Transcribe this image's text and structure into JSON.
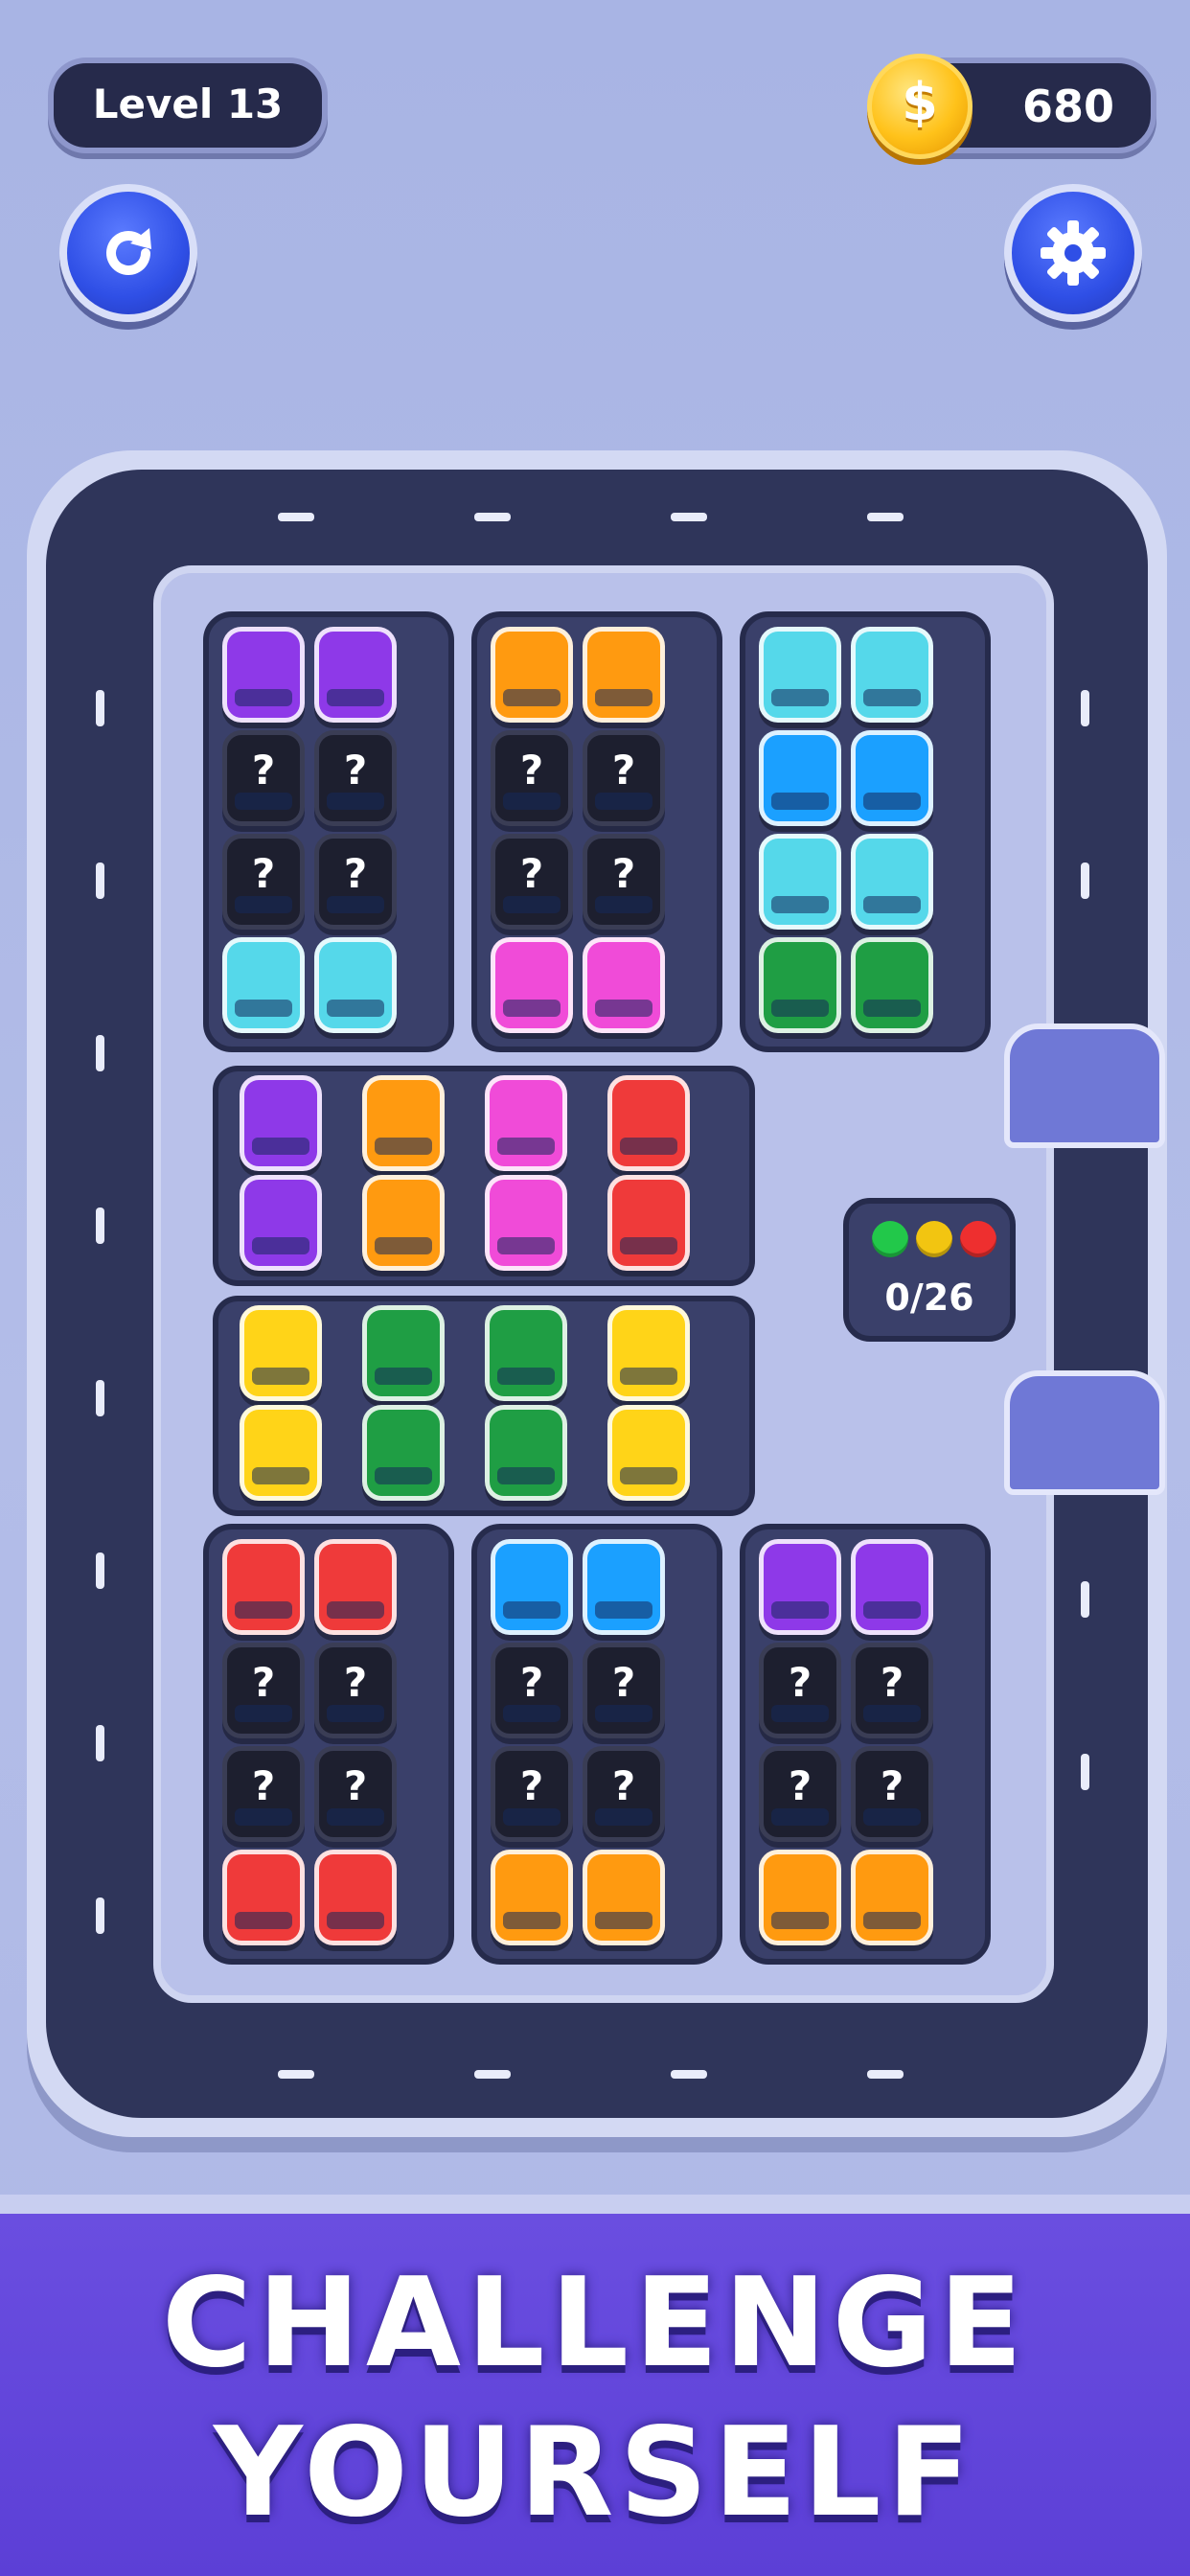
{
  "hud": {
    "level_label": "Level 13",
    "coins": "680",
    "coin_symbol": "$",
    "restart_icon": "restart-icon",
    "settings_icon": "gear-icon"
  },
  "counter": {
    "text": "0/26",
    "lights": [
      "#22c84a",
      "#f2c511",
      "#ee2f2f"
    ]
  },
  "colors": {
    "purple": "#8e39e8",
    "orange": "#ff9a10",
    "cyan": "#55d8ea",
    "blue": "#1ba0ff",
    "green": "#1f9e44",
    "pink": "#f04bd8",
    "red": "#ef3a3a",
    "yellow": "#ffd418"
  },
  "lots": {
    "top_left": [
      "purple",
      "purple",
      "?",
      "?",
      "?",
      "?",
      "cyan",
      "cyan"
    ],
    "top_mid": [
      "orange",
      "orange",
      "?",
      "?",
      "?",
      "?",
      "pink",
      "pink"
    ],
    "top_right": [
      "cyan",
      "cyan",
      "blue",
      "blue",
      "cyan",
      "cyan",
      "green",
      "green"
    ],
    "mid_row1": [
      "purple",
      "orange",
      "pink",
      "red",
      "purple",
      "orange",
      "pink",
      "red"
    ],
    "mid_row2": [
      "yellow",
      "green",
      "green",
      "yellow",
      "yellow",
      "green",
      "green",
      "yellow"
    ],
    "bot_left": [
      "red",
      "red",
      "?",
      "?",
      "?",
      "?",
      "red",
      "red"
    ],
    "bot_mid": [
      "blue",
      "blue",
      "?",
      "?",
      "?",
      "?",
      "orange",
      "orange"
    ],
    "bot_right": [
      "purple",
      "purple",
      "?",
      "?",
      "?",
      "?",
      "orange",
      "orange"
    ]
  },
  "banner": {
    "line1": "CHALLENGE",
    "line2": "YOURSELF"
  }
}
